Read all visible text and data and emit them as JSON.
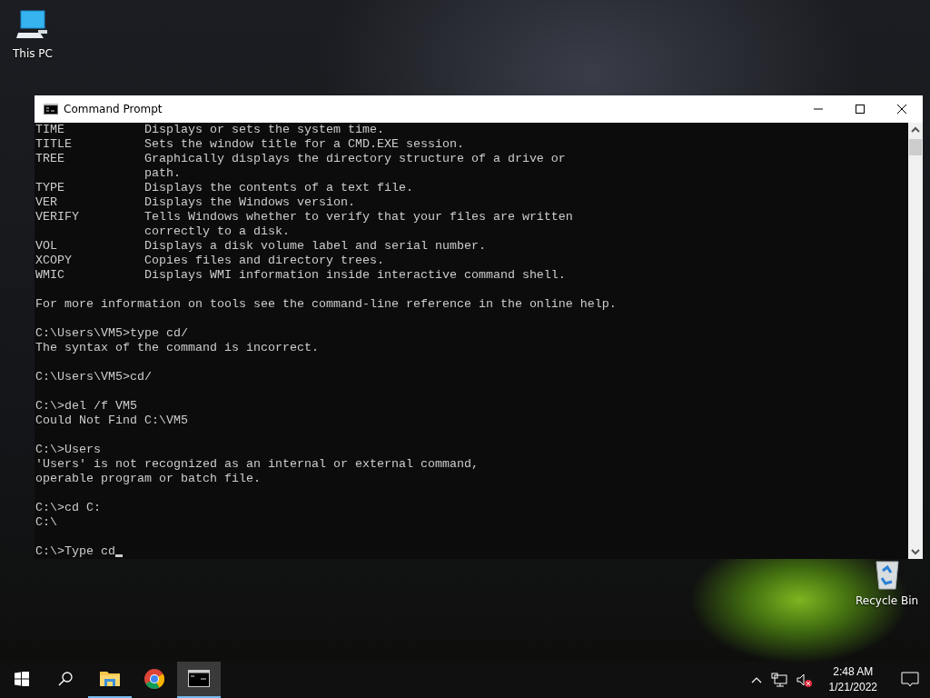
{
  "desktop_icons": [
    {
      "kind": "computer",
      "label": "This PC"
    },
    {
      "kind": "recycle",
      "label": "Recycle Bin"
    }
  ],
  "window": {
    "title": "Command Prompt",
    "console": {
      "blocks": [
        [
          "TIME           Displays or sets the system time.",
          "TITLE          Sets the window title for a CMD.EXE session.",
          "TREE           Graphically displays the directory structure of a drive or",
          "               path.",
          "TYPE           Displays the contents of a text file.",
          "VER            Displays the Windows version.",
          "VERIFY         Tells Windows whether to verify that your files are written",
          "               correctly to a disk.",
          "VOL            Displays a disk volume label and serial number.",
          "XCOPY          Copies files and directory trees.",
          "WMIC           Displays WMI information inside interactive command shell."
        ],
        [
          "For more information on tools see the command-line reference in the online help."
        ],
        [
          "C:\\Users\\VM5>type cd/",
          "The syntax of the command is incorrect."
        ],
        [
          "C:\\Users\\VM5>cd/"
        ],
        [
          "C:\\>del /f VM5",
          "Could Not Find C:\\VM5"
        ],
        [
          "C:\\>Users",
          "'Users' is not recognized as an internal or external command,",
          "operable program or batch file."
        ],
        [
          "C:\\>cd C:",
          "C:\\"
        ]
      ],
      "input": "C:\\>Type cd"
    }
  },
  "taskbar": {
    "items": [
      {
        "kind": "start",
        "running": false,
        "selected": false
      },
      {
        "kind": "search",
        "running": false,
        "selected": false
      },
      {
        "kind": "explorer",
        "running": true,
        "selected": false
      },
      {
        "kind": "browser",
        "running": false,
        "selected": false
      },
      {
        "kind": "terminal",
        "running": true,
        "selected": true
      }
    ],
    "tray": {
      "muted": true,
      "time": "2:48 AM",
      "date": "1/21/2022"
    }
  }
}
